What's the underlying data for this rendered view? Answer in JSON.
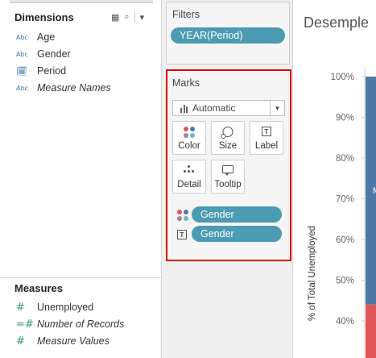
{
  "data_pane": {
    "dimensions": {
      "title": "Dimensions",
      "tools": {
        "grid_icon": "▦",
        "search_icon": "⌕",
        "menu_icon": "▾"
      },
      "fields": [
        {
          "type_icon": "Abc",
          "label": "Age",
          "italic": false
        },
        {
          "type_icon": "Abc",
          "label": "Gender",
          "italic": false
        },
        {
          "type_icon": "🗓",
          "label": "Period",
          "italic": false
        },
        {
          "type_icon": "Abc",
          "label": "Measure Names",
          "italic": true
        }
      ]
    },
    "measures": {
      "title": "Measures",
      "fields": [
        {
          "type_icon": "#",
          "label": "Unemployed",
          "italic": false
        },
        {
          "type_icon": "=#",
          "label": "Number of Records",
          "italic": true
        },
        {
          "type_icon": "#",
          "label": "Measure Values",
          "italic": true
        }
      ]
    }
  },
  "filters": {
    "title": "Filters",
    "pills": [
      "YEAR(Period)"
    ]
  },
  "marks": {
    "title": "Marks",
    "mark_type": "Automatic",
    "buttons": {
      "color": "Color",
      "size": "Size",
      "label": "Label",
      "detail": "Detail",
      "tooltip": "Tooltip"
    },
    "encodings": [
      {
        "encoding": "color",
        "field": "Gender"
      },
      {
        "encoding": "label",
        "field": "Gender"
      }
    ],
    "label_glyph": "T",
    "highlight_color": "#dd0000"
  },
  "chart": {
    "title": "Desemple",
    "ylabel": "% of Total Unemployed",
    "yticks": [
      "100%",
      "90%",
      "80%",
      "70%",
      "60%",
      "50%",
      "40%"
    ],
    "bar_label_fragment": "M",
    "colors": {
      "pill": "#4b9bb2",
      "bar_blue": "#4e79a7",
      "bar_red": "#e15759"
    }
  },
  "chart_data": {
    "type": "bar",
    "title": "Desemple",
    "ylabel": "% of Total Unemployed",
    "ylim": [
      0.4,
      1.0
    ],
    "series": [
      {
        "name": "M",
        "values_top": 1.0,
        "values_bottom": 0.44
      }
    ]
  }
}
